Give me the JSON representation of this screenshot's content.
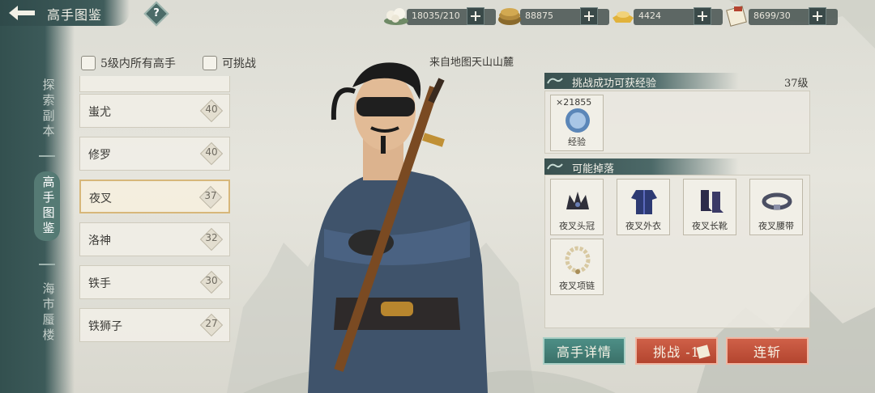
{
  "header": {
    "title": "高手图鉴",
    "help_label": "?"
  },
  "resources": [
    {
      "name": "stamina",
      "icon": "bun-icon",
      "value": "18035/210"
    },
    {
      "name": "copper",
      "icon": "coins-icon",
      "value": "88875"
    },
    {
      "name": "silver",
      "icon": "silver-icon",
      "value": "4424"
    },
    {
      "name": "tickets",
      "icon": "scroll-icon",
      "value": "8699/30"
    }
  ],
  "sidebar": {
    "tabs": [
      {
        "label": "探索副本",
        "active": false
      },
      {
        "label": "高手图鉴",
        "active": true
      },
      {
        "label": "海市蜃楼",
        "active": false
      }
    ]
  },
  "filters": {
    "all_masters_label": "5级内所有高手",
    "challengeable_label": "可挑战"
  },
  "masters": [
    {
      "name": "蚩尤",
      "level": "40"
    },
    {
      "name": "修罗",
      "level": "40"
    },
    {
      "name": "夜叉",
      "level": "37",
      "selected": true
    },
    {
      "name": "洛神",
      "level": "32"
    },
    {
      "name": "铁手",
      "level": "30"
    },
    {
      "name": "铁狮子",
      "level": "27"
    }
  ],
  "detail": {
    "source": "来自地图天山山麓",
    "exp_section": "挑战成功可获经验",
    "level_req": "37级",
    "exp_item": {
      "qty": "×21855",
      "label": "经验"
    },
    "drop_section": "可能掉落",
    "drops": [
      {
        "label": "夜叉头冠",
        "icon": "crown-icon"
      },
      {
        "label": "夜叉外衣",
        "icon": "robe-icon"
      },
      {
        "label": "夜叉长靴",
        "icon": "boots-icon"
      },
      {
        "label": "夜叉腰带",
        "icon": "belt-icon"
      },
      {
        "label": "夜叉项链",
        "icon": "necklace-icon"
      }
    ]
  },
  "actions": {
    "details": "高手详情",
    "challenge": "挑战 -1",
    "sweep": "连斩"
  },
  "colors": {
    "accent_teal": "#3f5c5b",
    "button_red": "#c0533c",
    "button_teal": "#44807a",
    "selected_border": "#d7b77a"
  }
}
